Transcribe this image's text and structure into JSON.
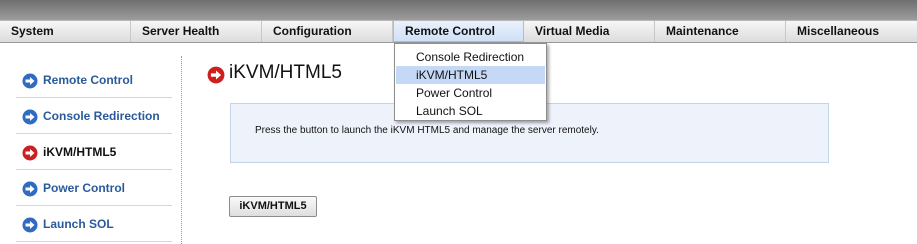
{
  "menubar": {
    "items": [
      {
        "label": "System"
      },
      {
        "label": "Server Health"
      },
      {
        "label": "Configuration"
      },
      {
        "label": "Remote Control"
      },
      {
        "label": "Virtual Media"
      },
      {
        "label": "Maintenance"
      },
      {
        "label": "Miscellaneous"
      }
    ],
    "active_index": 3
  },
  "dropdown": {
    "items": [
      {
        "label": "Console Redirection"
      },
      {
        "label": "iKVM/HTML5"
      },
      {
        "label": "Power Control"
      },
      {
        "label": "Launch SOL"
      }
    ],
    "highlighted": "iKVM/HTML5"
  },
  "sidebar": {
    "items": [
      {
        "label": "Remote Control",
        "icon": "arrow-right-circle-icon"
      },
      {
        "label": "Console Redirection",
        "icon": "arrow-right-circle-icon"
      },
      {
        "label": "iKVM/HTML5",
        "icon": "arrow-right-circle-red-icon",
        "current": true
      },
      {
        "label": "Power Control",
        "icon": "arrow-right-circle-icon"
      },
      {
        "label": "Launch SOL",
        "icon": "arrow-right-circle-icon"
      }
    ]
  },
  "main": {
    "title": "iKVM/HTML5",
    "description": "Press the button to launch the iKVM HTML5 and manage the server remotely.",
    "button_label": "iKVM/HTML5"
  },
  "colors": {
    "link_blue": "#2a5a9b",
    "icon_blue": "#2f6bc0",
    "icon_red": "#cc1f1f",
    "highlight": "#c5d9f6"
  }
}
